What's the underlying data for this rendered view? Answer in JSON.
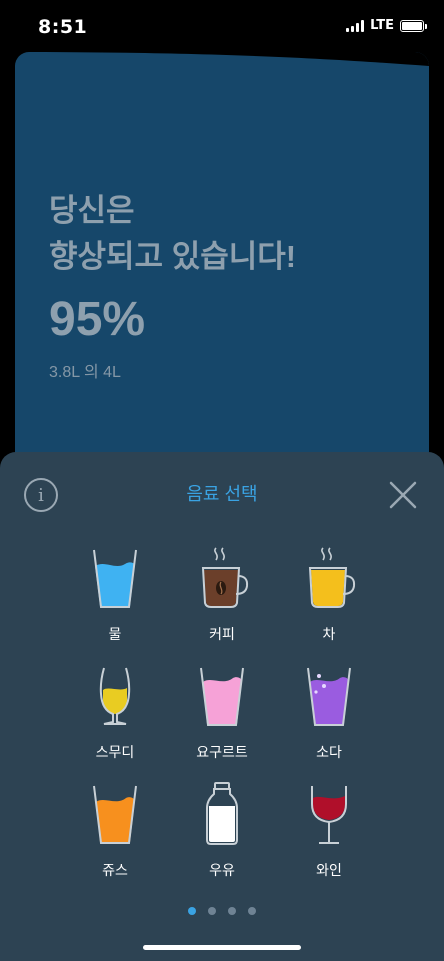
{
  "status_bar": {
    "time": "8:51",
    "network": "LTE"
  },
  "progress_card": {
    "title_line1": "당신은",
    "title_line2": "향상되고 있습니다!",
    "percent": "95%",
    "amount": "3.8L 의 4L",
    "progress_fraction": 0.95,
    "background_color": "#16476a"
  },
  "sheet": {
    "title": "음료 선택",
    "info_icon": "info-icon",
    "close_icon": "close-icon",
    "background_color": "#2d4353",
    "accent_color": "#3aa3e3"
  },
  "drinks": [
    {
      "label": "물",
      "icon": "water-glass-icon",
      "color": "#3fb2f2"
    },
    {
      "label": "커피",
      "icon": "coffee-cup-icon",
      "color": "#6b3f2a"
    },
    {
      "label": "차",
      "icon": "tea-cup-icon",
      "color": "#f4bf1c"
    },
    {
      "label": "스무디",
      "icon": "smoothie-glass-icon",
      "color": "#e9cc22"
    },
    {
      "label": "요구르트",
      "icon": "yogurt-glass-icon",
      "color": "#f6a2d7"
    },
    {
      "label": "소다",
      "icon": "soda-glass-icon",
      "color": "#9a5ce0"
    },
    {
      "label": "쥬스",
      "icon": "juice-glass-icon",
      "color": "#f7901e"
    },
    {
      "label": "우유",
      "icon": "milk-bottle-icon",
      "color": "#ffffff"
    },
    {
      "label": "와인",
      "icon": "wine-glass-icon",
      "color": "#b00f2a"
    }
  ],
  "pager": {
    "page_count": 4,
    "current_page": 1
  }
}
